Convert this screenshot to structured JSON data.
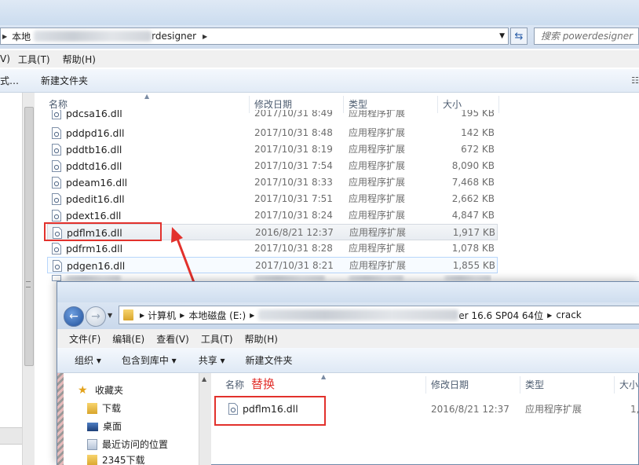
{
  "back_window": {
    "address_prefix": "本地",
    "address_suffix": "rdesigner",
    "address_sep": "▶",
    "search_placeholder": "搜索 powerdesigner",
    "menu": [
      "V)",
      "工具(T)",
      "帮助(H)"
    ],
    "toolbar_left": "式…",
    "toolbar_newfolder": "新建文件夹",
    "columns": {
      "name": "名称",
      "date": "修改日期",
      "type": "类型",
      "size": "大小"
    },
    "files": [
      {
        "name": "pdcsa16.dll",
        "date": "2017/10/31 8:49",
        "type": "应用程序扩展",
        "size": "195 KB"
      },
      {
        "name": "pddpd16.dll",
        "date": "2017/10/31 8:48",
        "type": "应用程序扩展",
        "size": "142 KB"
      },
      {
        "name": "pddtb16.dll",
        "date": "2017/10/31 8:19",
        "type": "应用程序扩展",
        "size": "672 KB"
      },
      {
        "name": "pddtd16.dll",
        "date": "2017/10/31 7:54",
        "type": "应用程序扩展",
        "size": "8,090 KB"
      },
      {
        "name": "pdeam16.dll",
        "date": "2017/10/31 8:33",
        "type": "应用程序扩展",
        "size": "7,468 KB"
      },
      {
        "name": "pdedit16.dll",
        "date": "2017/10/31 7:51",
        "type": "应用程序扩展",
        "size": "2,662 KB"
      },
      {
        "name": "pdext16.dll",
        "date": "2017/10/31 8:24",
        "type": "应用程序扩展",
        "size": "4,847 KB"
      },
      {
        "name": "pdflm16.dll",
        "date": "2016/8/21 12:37",
        "type": "应用程序扩展",
        "size": "1,917 KB"
      },
      {
        "name": "pdfrm16.dll",
        "date": "2017/10/31 8:28",
        "type": "应用程序扩展",
        "size": "1,078 KB"
      },
      {
        "name": "pdgen16.dll",
        "date": "2017/10/31 8:21",
        "type": "应用程序扩展",
        "size": "1,855 KB"
      }
    ]
  },
  "front_window": {
    "address_computer": "计算机",
    "address_disk": "本地磁盘 (E:)",
    "address_folder": "er 16.6 SP04 64位",
    "address_crack": "crack",
    "address_sep": "▶",
    "menu": [
      "文件(F)",
      "编辑(E)",
      "查看(V)",
      "工具(T)",
      "帮助(H)"
    ],
    "toolbar": {
      "organize": "组织 ▾",
      "include": "包含到库中 ▾",
      "share": "共享 ▾",
      "newfolder": "新建文件夹"
    },
    "nav": [
      "收藏夹",
      "下载",
      "桌面",
      "最近访问的位置",
      "2345下载"
    ],
    "columns": {
      "name": "名称",
      "date": "修改日期",
      "type": "类型",
      "size": "大小"
    },
    "file": {
      "name": "pdflm16.dll",
      "date": "2016/8/21 12:37",
      "type": "应用程序扩展",
      "size": "1,"
    }
  },
  "annotation": {
    "label": "替换",
    "color": "#e2312c"
  }
}
